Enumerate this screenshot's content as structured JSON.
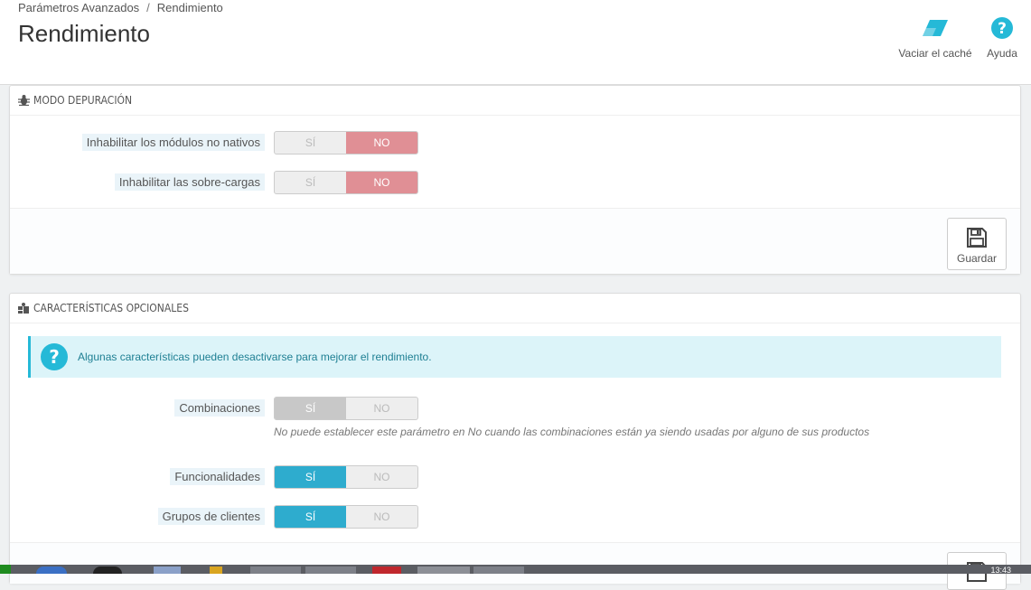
{
  "breadcrumb": {
    "parent": "Parámetros Avanzados",
    "separator": "/",
    "current": "Rendimiento"
  },
  "page_title": "Rendimiento",
  "toolbar": {
    "clear_cache": "Vaciar el caché",
    "help": "Ayuda"
  },
  "debug_panel": {
    "heading": "MODO DEPURACIÓN",
    "rows": [
      {
        "label": "Inhabilitar los módulos no nativos",
        "yes": "SÍ",
        "no": "NO",
        "selected": "no"
      },
      {
        "label": "Inhabilitar las sobre-cargas",
        "yes": "SÍ",
        "no": "NO",
        "selected": "no"
      }
    ],
    "save_label": "Guardar"
  },
  "features_panel": {
    "heading": "CARACTERÍSTICAS OPCIONALES",
    "info": "Algunas características pueden desactivarse para mejorar el rendimiento.",
    "rows": [
      {
        "label": "Combinaciones",
        "yes": "SÍ",
        "no": "NO",
        "selected": "yes",
        "disabled": true,
        "help": "No puede establecer este parámetro en No cuando las combinaciones están ya siendo usadas por alguno de sus productos"
      },
      {
        "label": "Funcionalidades",
        "yes": "SÍ",
        "no": "NO",
        "selected": "yes"
      },
      {
        "label": "Grupos de clientes",
        "yes": "SÍ",
        "no": "NO",
        "selected": "yes"
      }
    ]
  },
  "taskbar": {
    "clock": "13:43"
  },
  "colors": {
    "accent": "#25b9d7",
    "switch_on": "#2eacce",
    "switch_no": "#e08f95"
  }
}
